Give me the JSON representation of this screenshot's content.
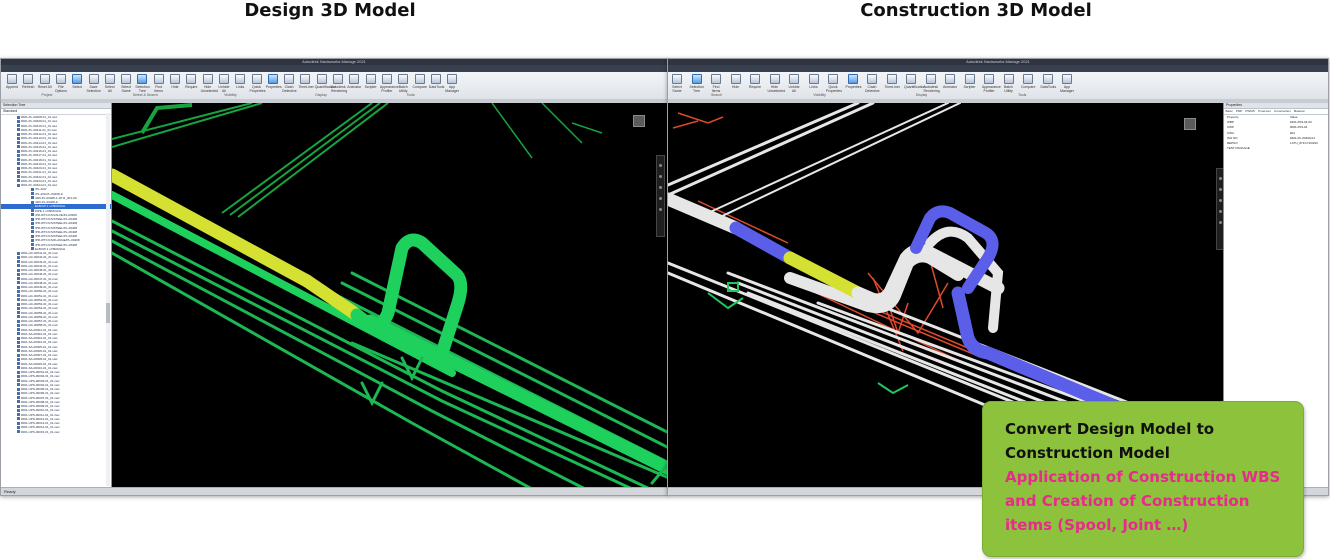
{
  "headings": {
    "design": "Design 3D Model",
    "construction": "Construction 3D Model"
  },
  "design_window": {
    "title": "Autodesk Navisworks Manage 2021",
    "tabs": [
      "Home",
      "Viewpoint",
      "Review",
      "Animation",
      "View",
      "Output",
      "Item Tools",
      "BIM 360 Glue",
      "Render",
      "Naviatools VC",
      "Tool add-ins 1"
    ],
    "active_tab": "Item Tools",
    "ribbon_buttons": [
      "Append",
      "Refresh",
      "Reset All",
      "File Options",
      "Select",
      "Save Selection",
      "Select All",
      "Select Same",
      "Selection Tree",
      "Find Items",
      "Hide",
      "Require",
      "Hide Unselected",
      "Unhide All",
      "Links",
      "Quick Properties",
      "Properties",
      "Clash Detective",
      "TimeLiner",
      "Quantification",
      "Autodesk Rendering",
      "Animator",
      "Scripter",
      "Appearance Profiler",
      "Batch Utility",
      "Compare",
      "DataTools",
      "App Manager"
    ],
    "ribbon_groups": [
      "Project",
      "Select & Search",
      "Visibility",
      "Display",
      "Tools"
    ],
    "selection_tree": {
      "title": "Selection Tree",
      "mode": "Standard",
      "top_items": [
        "#001-PL-00408-01_01.nwc",
        "#001-PL-00409-01_01.nwc",
        "#001-PL-00410-01_01.nwc",
        "#001-PL-00411-01_01.nwc",
        "#001-PL-00412-01_01.nwc",
        "#001-PL-00413-01_01.nwc",
        "#001-PL-00414-01_01.nwc",
        "#001-PL-00415-01_01.nwc",
        "#001-PL-00416-01_01.nwc",
        "#001-PL-00417-01_01.nwc",
        "#001-PL-00418-01_01.nwc",
        "#001-PL-00419-01_01.nwc",
        "#001-PL-00420-01_01.nwc",
        "#001-PL-00421-01_01.nwc",
        "#001-PL-00422-01_01.nwc",
        "#001-PL-00423-01_01.nwc",
        "#001-PL-00424-01_01.nwc"
      ],
      "expanded_items": [
        "/PL-400/",
        "/PL-400-PL-00408-1/",
        "/400-PL-00408-1-1P-R_001-01/",
        "/400-PL-00408-1/",
        "ELBOW 1 of BRANCH",
        "PIPE 1 of BRANCH",
        "/PR-WTC/CS/VALVE/PL-00408",
        "/PR-WTC/CS/STEEL/PL-00408",
        "/PR-WTC/CS/STEEL/PL-00408",
        "/PR-WTC/CS/STEEL/PL-00408",
        "/PR-WTC/CS/STEEL/PL-00408",
        "/PR-WTC/CS/STEEL/PL-00408",
        "/PR-WTC/CS/FLANGE/PL-00408",
        "/PR-WTC/CS/STEEL/PL-00408",
        "ELBOW 2 of BRANCH"
      ],
      "bottom_items": [
        "#001-HC-00041-01_01.nwc",
        "#001-HC-00042-01_01.nwc",
        "#001-HC-00043-01_01.nwc",
        "#001-HC-00044-01_01.nwc",
        "#001-HC-00045-01_01.nwc",
        "#001-HC-00046-01_01.nwc",
        "#001-HC-00047-01_01.nwc",
        "#001-HC-00048-01_01.nwc",
        "#001-HC-00049-01_01.nwc",
        "#001-HC-00050-01_01.nwc",
        "#001-HC-00051-01_01.nwc",
        "#001-HC-00052-01_01.nwc",
        "#001-HC-00053-01_01.nwc",
        "#001-HC-00054-01_01.nwc",
        "#001-HC-00055-01_01.nwc",
        "#001-HC-00056-01_01.nwc",
        "#001-HC-00057-01_01.nwc",
        "#001-HC-00058-01_01.nwc",
        "#001-SA-00001-01_01.nwc",
        "#001-SA-00002-01_01.nwc",
        "#001-SA-00003-01_01.nwc",
        "#001-SA-00004-01_01.nwc",
        "#001-SA-00005-01_01.nwc",
        "#001-SA-00006-01_01.nwc",
        "#001-SA-00007-01_01.nwc",
        "#001-SA-00008-01_01.nwc",
        "#001-SA-00009-01_01.nwc",
        "#001-SA-00010-01_01.nwc",
        "#001-UPS-00001-01_01.nwc",
        "#001-UPS-00002-01_01.nwc",
        "#001-UPS-00003-01_01.nwc",
        "#001-UPS-00004-01_01.nwc",
        "#001-UPS-00005-01_01.nwc",
        "#001-UPS-00006-01_01.nwc",
        "#001-UPS-00007-01_01.nwc",
        "#001-UPS-00008-01_01.nwc",
        "#001-UPS-00009-01_01.nwc",
        "#001-UPS-00010-01_01.nwc",
        "#001-UPS-00011-01_01.nwc",
        "#001-UPS-00012-01_01.nwc",
        "#001-UPS-00013-01_01.nwc",
        "#001-UPS-00014-01_01.nwc",
        "#001-UPS-00015-01_01.nwc"
      ]
    },
    "status": "Ready"
  },
  "construction_window": {
    "title": "Autodesk Navisworks Manage 2021",
    "tabs": [
      "Item Tools",
      "BIM 360 Glue",
      "Render",
      "Naviatools VC",
      "Tool add-ins 1"
    ],
    "active_tab": "Item Tools",
    "ribbon_buttons": [
      "Select Same",
      "Selection Tree",
      "Find Items",
      "Hide",
      "Require",
      "Hide Unselected",
      "Unhide All",
      "Links",
      "Quick Properties",
      "Properties",
      "Clash Detective",
      "TimeLiner",
      "Quantification",
      "Autodesk Rendering",
      "Animator",
      "Scripter",
      "Appearance Profiler",
      "Batch Utility",
      "Compare",
      "DataTools",
      "App Manager"
    ],
    "ribbon_groups": [
      "Search",
      "Visibility",
      "Display",
      "Tools"
    ],
    "properties": {
      "title": "Properties",
      "tabs": [
        "Basic",
        "PMP",
        "PWMS",
        "TimeLiner",
        "Construction",
        "Material"
      ],
      "rows": [
        {
          "key": "Property",
          "value": "Value"
        },
        {
          "key": "WBP",
          "value": "#401-P03-04-03"
        },
        {
          "key": "CWP",
          "value": "#001-P03-04"
        },
        {
          "key": "CWA",
          "value": "#01"
        },
        {
          "key": "ISO NO",
          "value": "#401-PL-00409-01"
        },
        {
          "key": "REPNO",
          "value": "LSTU_#71/1710/294"
        },
        {
          "key": "TEST PACKAGE",
          "value": ""
        }
      ]
    }
  },
  "callout": {
    "line1": "Convert Design Model to",
    "line2": "Construction Model",
    "line3": "Application of Construction WBS",
    "line4": "and Creation of Construction",
    "line5": "items (Spool, Joint …)"
  },
  "colors": {
    "callout_bg": "#8dc33c",
    "callout_accent": "#e72a8c",
    "pipe_green": "#22c55e",
    "pipe_yellow": "#d4e032",
    "pipe_blue": "#5a5ee8",
    "pipe_white": "#e6e6e6",
    "spool_red": "#e04a2c"
  }
}
